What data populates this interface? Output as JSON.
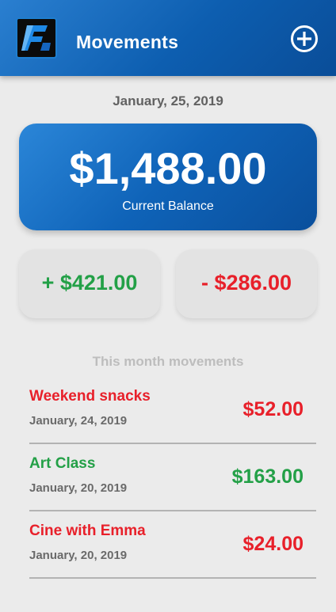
{
  "header": {
    "title": "Movements",
    "logo_icon": "app-logo-icon",
    "add_icon": "add-circle-icon"
  },
  "date": "January, 25, 2019",
  "balance": {
    "amount": "$1,488.00",
    "label": "Current Balance"
  },
  "income": "+ $421.00",
  "expense": "- $286.00",
  "section_label": "This month movements",
  "movements": [
    {
      "name": "Weekend snacks",
      "date": "January, 24, 2019",
      "amount": "$52.00",
      "type": "expense"
    },
    {
      "name": "Art Class",
      "date": "January, 20, 2019",
      "amount": "$163.00",
      "type": "income"
    },
    {
      "name": "Cine with Emma",
      "date": "January, 20, 2019",
      "amount": "$24.00",
      "type": "expense"
    }
  ],
  "colors": {
    "brand_blue": "#0d5eb0",
    "income_green": "#23a047",
    "expense_red": "#e8202a"
  }
}
